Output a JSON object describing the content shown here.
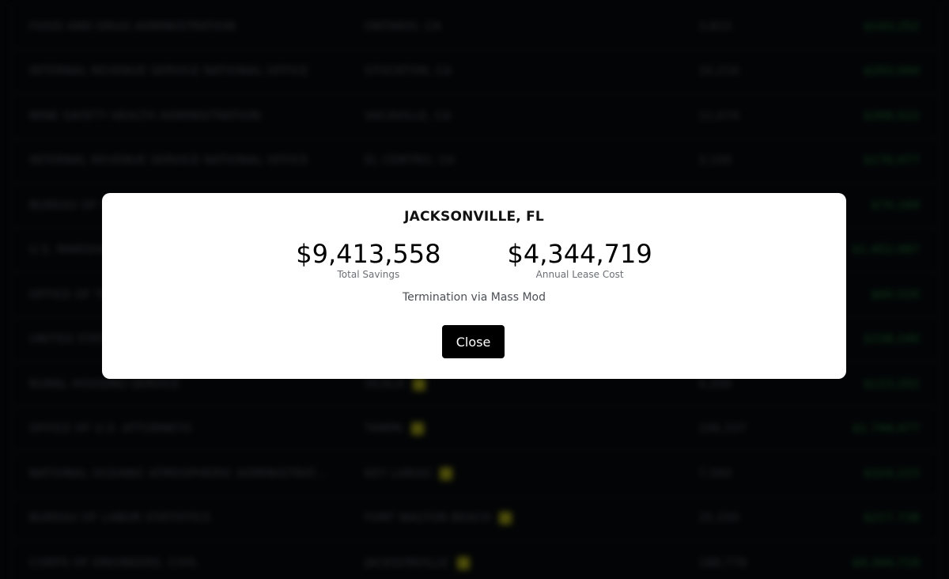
{
  "table": {
    "rows": [
      {
        "agency": "FOOD AND DRUG ADMINISTRATION",
        "city": "ONTARIO, CA",
        "badge": false,
        "sqft": "3,815",
        "savings": "$143,252"
      },
      {
        "agency": "INTERNAL REVENUE SERVICE NATIONAL OFFICE",
        "city": "STOCKTON, CA",
        "badge": false,
        "sqft": "10,216",
        "savings": "$203,044"
      },
      {
        "agency": "MINE SAFETY HEALTH ADMINISTRATION",
        "city": "VACAVILLE, CA",
        "badge": false,
        "sqft": "11,074",
        "savings": "$306,522"
      },
      {
        "agency": "INTERNAL REVENUE SERVICE NATIONAL OFFICE",
        "city": "EL CENTRO, CA",
        "badge": false,
        "sqft": "3,100",
        "savings": "$176,477"
      },
      {
        "agency": "BUREAU OF INDIAN AFFAIRS",
        "city": "",
        "badge": false,
        "sqft": "",
        "savings": "$74,169"
      },
      {
        "agency": "U.S. MARSHALS SERVICE",
        "city": "",
        "badge": false,
        "sqft": "",
        "savings": "$1,452,987"
      },
      {
        "agency": "OFFICE OF THE SECRETARY",
        "city": "",
        "badge": false,
        "sqft": "",
        "savings": "$60,520"
      },
      {
        "agency": "UNITED STATES ARMY",
        "city": "",
        "badge": false,
        "sqft": "",
        "savings": "$338,240"
      },
      {
        "agency": "RURAL HOUSING SERVICE",
        "city": "OCALA",
        "badge": true,
        "sqft": "4,200",
        "savings": "$123,202"
      },
      {
        "agency": "OFFICE OF U.S. ATTORNEYS",
        "city": "TAMPA",
        "badge": true,
        "sqft": "106,337",
        "savings": "$1,744,477"
      },
      {
        "agency": "NATIONAL OCEANIC ATMOSPHERIC ADMINISTRATI...",
        "city": "KEY LARGO",
        "badge": true,
        "sqft": "7,593",
        "savings": "$324,223"
      },
      {
        "agency": "BUREAU OF LABOR STATISTICS",
        "city": "FORT WALTON BEACH",
        "badge": true,
        "sqft": "15,250",
        "savings": "$217,738"
      },
      {
        "agency": "CORPS OF ENGINEERS, CIVIL",
        "city": "JACKSONVILLE",
        "badge": true,
        "sqft": "188,778",
        "savings": "$4,344,719"
      }
    ]
  },
  "modal": {
    "title": "JACKSONVILLE, FL",
    "total_savings": "$9,413,558",
    "total_savings_label": "Total Savings",
    "annual_lease": "$4,344,719",
    "annual_lease_label": "Annual Lease Cost",
    "method": "Termination via Mass Mod",
    "close_label": "Close"
  }
}
